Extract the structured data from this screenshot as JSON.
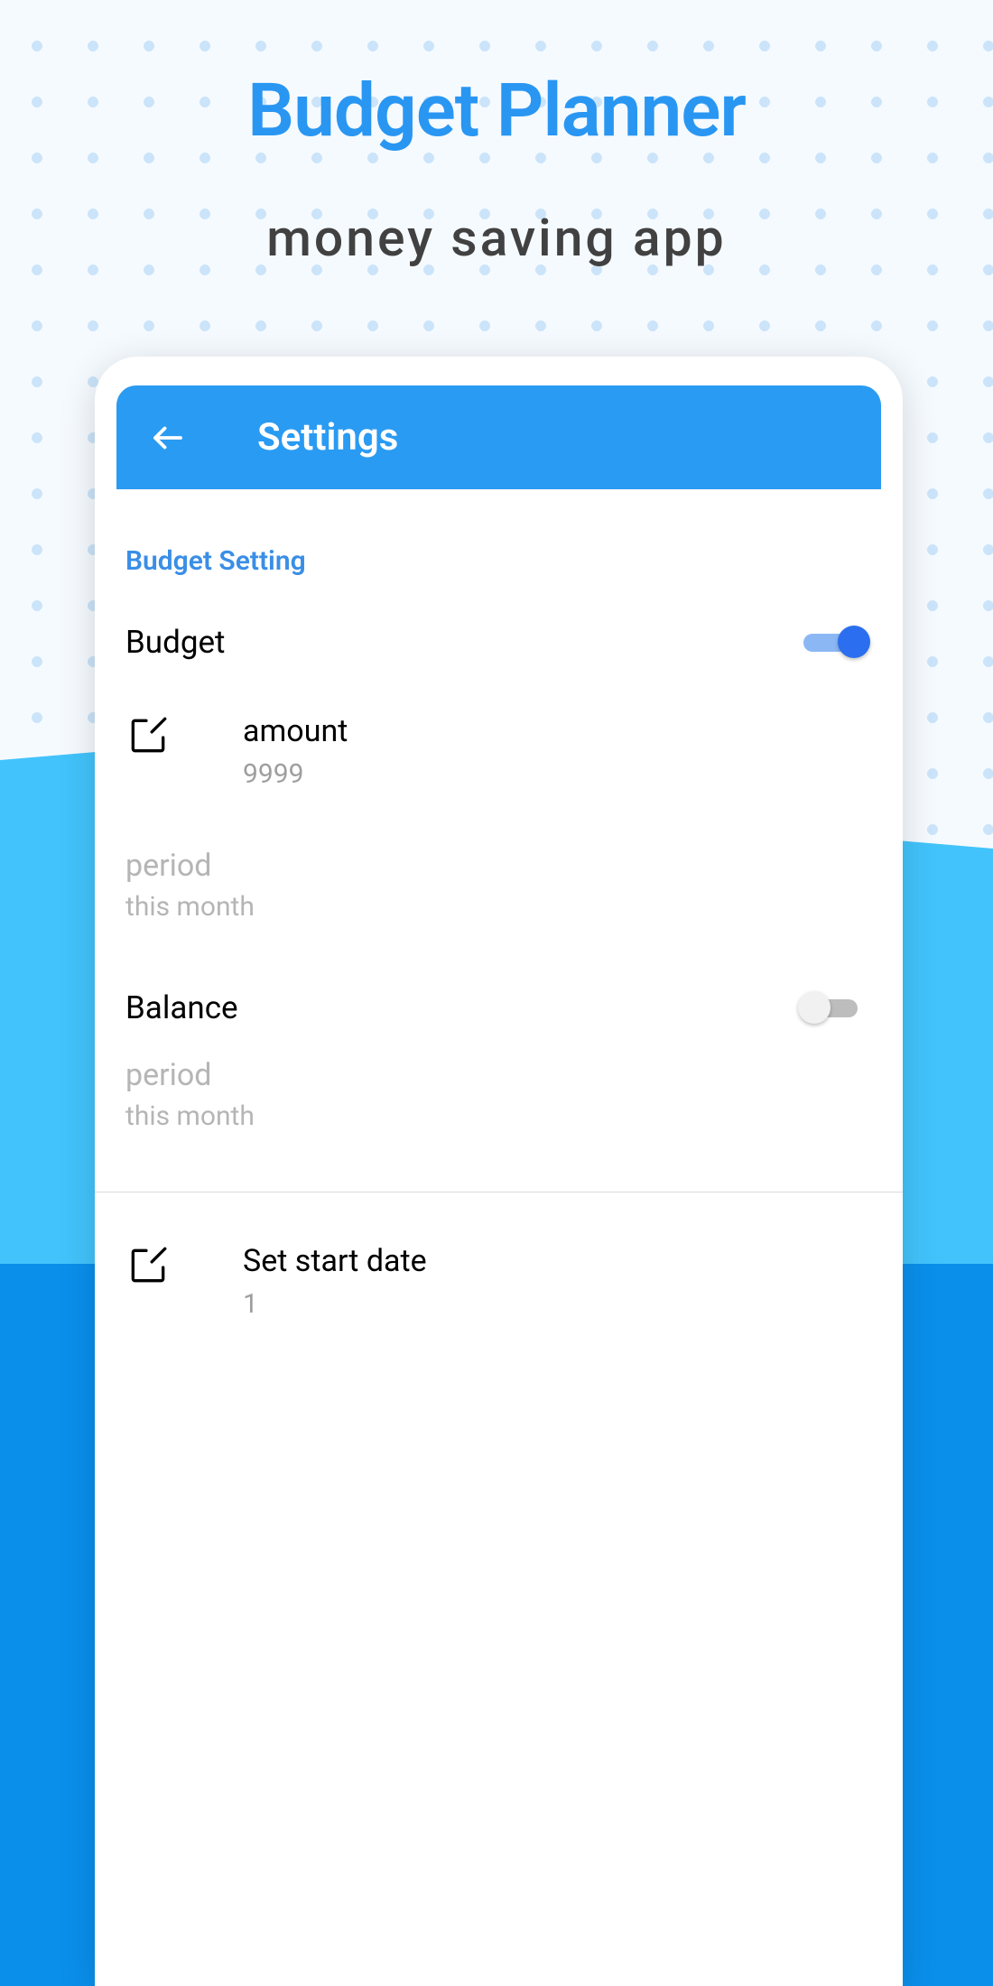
{
  "promo": {
    "title": "Budget Planner",
    "subtitle": "money saving app"
  },
  "screen": {
    "appbar_title": "Settings",
    "section_title": "Budget Setting",
    "budget": {
      "label": "Budget",
      "toggle_on": true
    },
    "amount": {
      "label": "amount",
      "value": "9999"
    },
    "period1": {
      "label": "period",
      "value": "this month"
    },
    "balance": {
      "label": "Balance",
      "toggle_on": false
    },
    "period2": {
      "label": "period",
      "value": "this month"
    },
    "start_date": {
      "label": "Set start date",
      "value": "1"
    }
  }
}
